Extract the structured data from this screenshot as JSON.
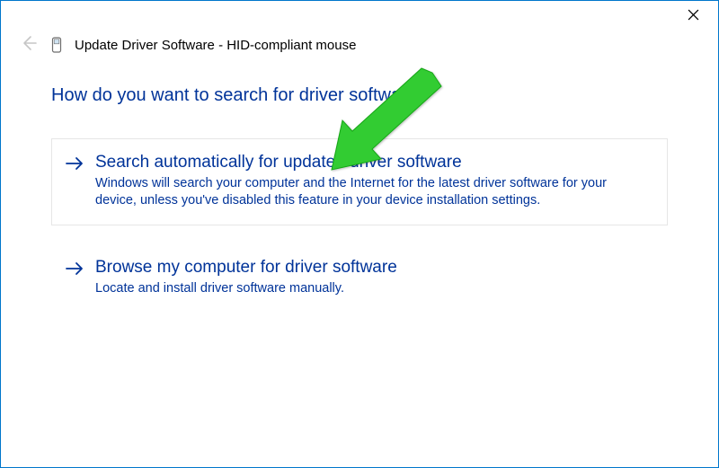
{
  "titlebar": {
    "close_tooltip": "Close"
  },
  "header": {
    "title": "Update Driver Software - HID-compliant mouse"
  },
  "main": {
    "question": "How do you want to search for driver software?",
    "options": [
      {
        "title": "Search automatically for updated driver software",
        "description": "Windows will search your computer and the Internet for the latest driver software for your device, unless you've disabled this feature in your device installation settings."
      },
      {
        "title": "Browse my computer for driver software",
        "description": "Locate and install driver software manually."
      }
    ]
  },
  "annotation": {
    "color": "#33cc33"
  }
}
